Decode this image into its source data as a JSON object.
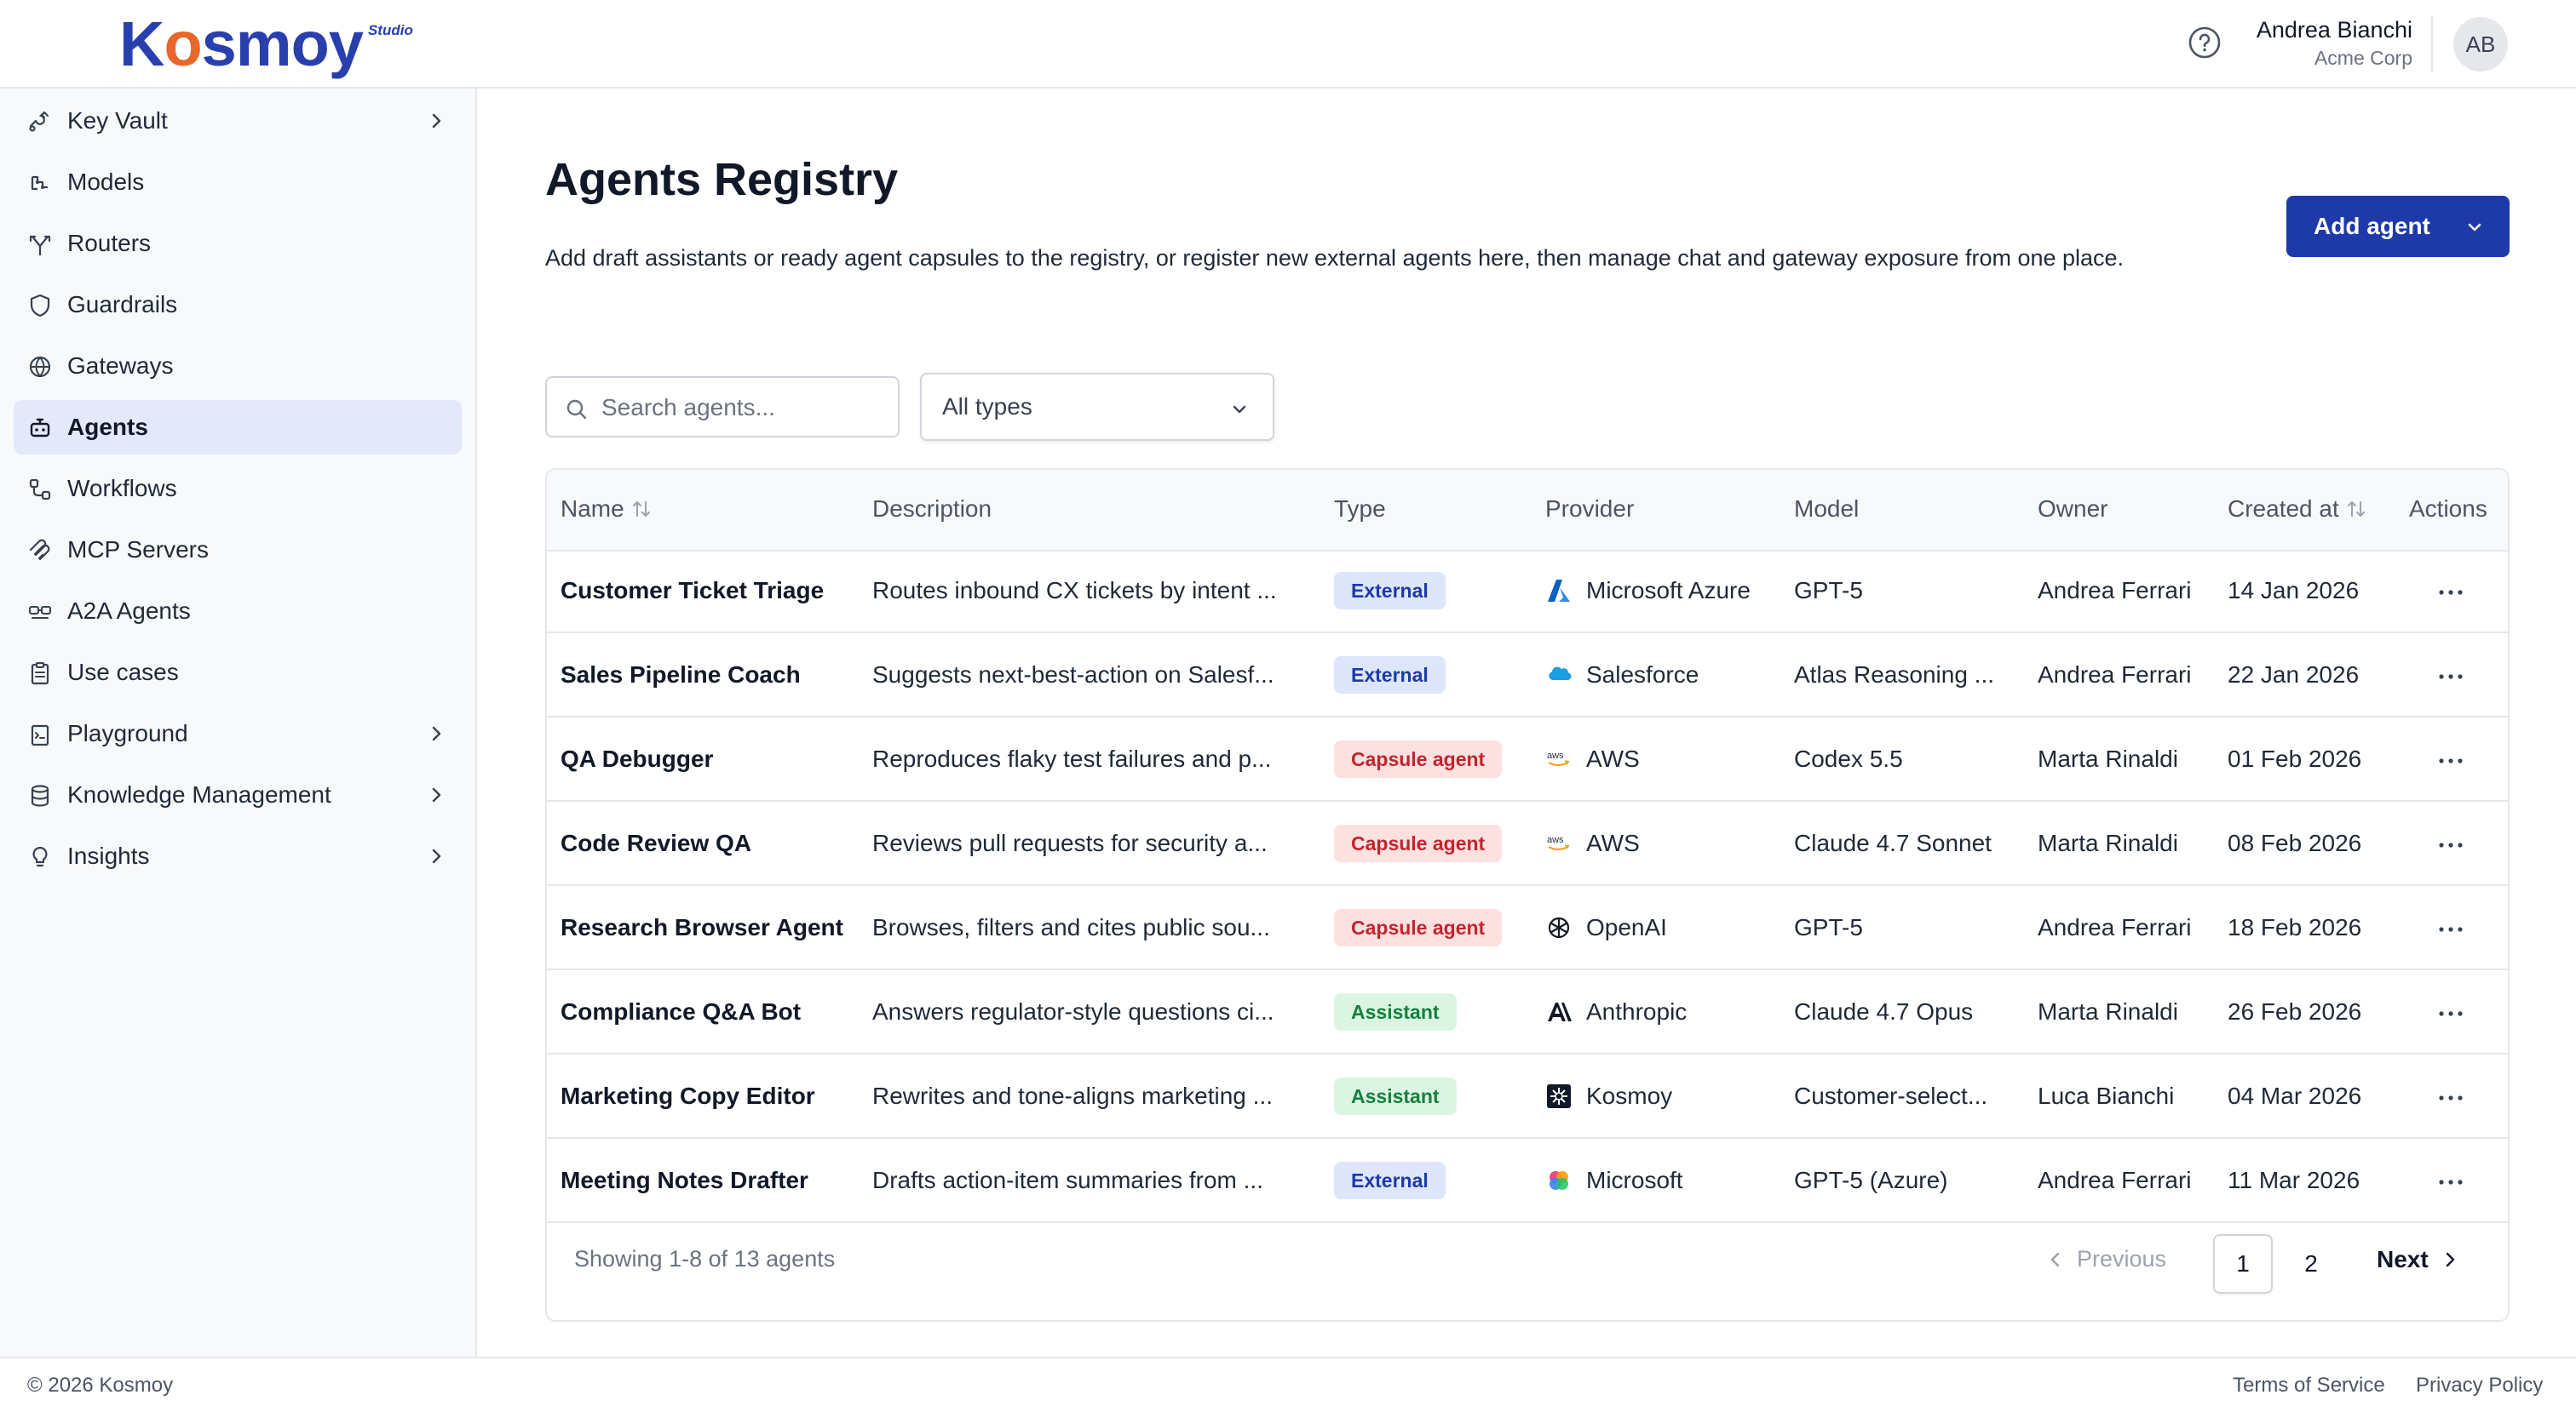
{
  "header": {
    "logo_main_pre": "K",
    "logo_main_o": "o",
    "logo_main_post": "smoy",
    "logo_studio": "Studio",
    "user_name": "Andrea Bianchi",
    "user_org": "Acme Corp",
    "avatar_initials": "AB",
    "brand_color": "#2a3fae",
    "accent_color": "#e8672b"
  },
  "sidebar": {
    "items": [
      {
        "label": "Key Vault",
        "icon": "key-vault-icon",
        "has_children": true
      },
      {
        "label": "Models",
        "icon": "models-icon",
        "has_children": false
      },
      {
        "label": "Routers",
        "icon": "routers-icon",
        "has_children": false
      },
      {
        "label": "Guardrails",
        "icon": "shield-icon",
        "has_children": false
      },
      {
        "label": "Gateways",
        "icon": "globe-icon",
        "has_children": false
      },
      {
        "label": "Agents",
        "icon": "robot-icon",
        "has_children": false,
        "active": true
      },
      {
        "label": "Workflows",
        "icon": "workflow-icon",
        "has_children": false
      },
      {
        "label": "MCP Servers",
        "icon": "mcp-icon",
        "has_children": false
      },
      {
        "label": "A2A Agents",
        "icon": "a2a-icon",
        "has_children": false
      },
      {
        "label": "Use cases",
        "icon": "clipboard-icon",
        "has_children": false
      },
      {
        "label": "Playground",
        "icon": "playground-icon",
        "has_children": true
      },
      {
        "label": "Knowledge Management",
        "icon": "database-icon",
        "has_children": true
      },
      {
        "label": "Insights",
        "icon": "lightbulb-icon",
        "has_children": true
      }
    ]
  },
  "main": {
    "title": "Agents Registry",
    "description": "Add draft assistants or ready agent capsules to the registry, or register new external agents here, then manage chat and gateway exposure from one place.",
    "add_button_label": "Add agent",
    "search_placeholder": "Search agents...",
    "type_filter_value": "All types"
  },
  "table": {
    "columns": [
      "Name",
      "Description",
      "Type",
      "Provider",
      "Model",
      "Owner",
      "Created at",
      "Actions"
    ],
    "rows": [
      {
        "name": "Customer Ticket Triage",
        "description": "Routes inbound CX tickets by intent ...",
        "type": "External",
        "type_kind": "external",
        "provider": "Microsoft Azure",
        "provider_icon": "azure-icon",
        "model": "GPT-5",
        "owner": "Andrea Ferrari",
        "created": "14 Jan 2026"
      },
      {
        "name": "Sales Pipeline Coach",
        "description": "Suggests next-best-action on Salesf...",
        "type": "External",
        "type_kind": "external",
        "provider": "Salesforce",
        "provider_icon": "salesforce-icon",
        "model": "Atlas Reasoning ...",
        "owner": "Andrea Ferrari",
        "created": "22 Jan 2026"
      },
      {
        "name": "QA Debugger",
        "description": "Reproduces flaky test failures and p...",
        "type": "Capsule agent",
        "type_kind": "capsule",
        "provider": "AWS",
        "provider_icon": "aws-icon",
        "model": "Codex 5.5",
        "owner": "Marta Rinaldi",
        "created": "01 Feb 2026"
      },
      {
        "name": "Code Review QA",
        "description": "Reviews pull requests for security a...",
        "type": "Capsule agent",
        "type_kind": "capsule",
        "provider": "AWS",
        "provider_icon": "aws-icon",
        "model": "Claude 4.7 Sonnet",
        "owner": "Marta Rinaldi",
        "created": "08 Feb 2026"
      },
      {
        "name": "Research Browser Agent",
        "description": "Browses, filters and cites public sou...",
        "type": "Capsule agent",
        "type_kind": "capsule",
        "provider": "OpenAI",
        "provider_icon": "openai-icon",
        "model": "GPT-5",
        "owner": "Andrea Ferrari",
        "created": "18 Feb 2026"
      },
      {
        "name": "Compliance Q&A Bot",
        "description": "Answers regulator-style questions ci...",
        "type": "Assistant",
        "type_kind": "assistant",
        "provider": "Anthropic",
        "provider_icon": "anthropic-icon",
        "model": "Claude 4.7 Opus",
        "owner": "Marta Rinaldi",
        "created": "26 Feb 2026"
      },
      {
        "name": "Marketing Copy Editor",
        "description": "Rewrites and tone-aligns marketing ...",
        "type": "Assistant",
        "type_kind": "assistant",
        "provider": "Kosmoy",
        "provider_icon": "kosmoy-icon",
        "model": "Customer-select...",
        "owner": "Luca Bianchi",
        "created": "04 Mar 2026"
      },
      {
        "name": "Meeting Notes Drafter",
        "description": "Drafts action-item summaries from ...",
        "type": "External",
        "type_kind": "external",
        "provider": "Microsoft",
        "provider_icon": "microsoft-icon",
        "model": "GPT-5 (Azure)",
        "owner": "Andrea Ferrari",
        "created": "11 Mar 2026"
      }
    ]
  },
  "pagination": {
    "summary": "Showing 1-8 of 13 agents",
    "previous_label": "Previous",
    "pages": [
      "1",
      "2"
    ],
    "current_page": "1",
    "next_label": "Next"
  },
  "footer": {
    "copyright": "© 2026 Kosmoy",
    "terms": "Terms of Service",
    "privacy": "Privacy Policy"
  }
}
